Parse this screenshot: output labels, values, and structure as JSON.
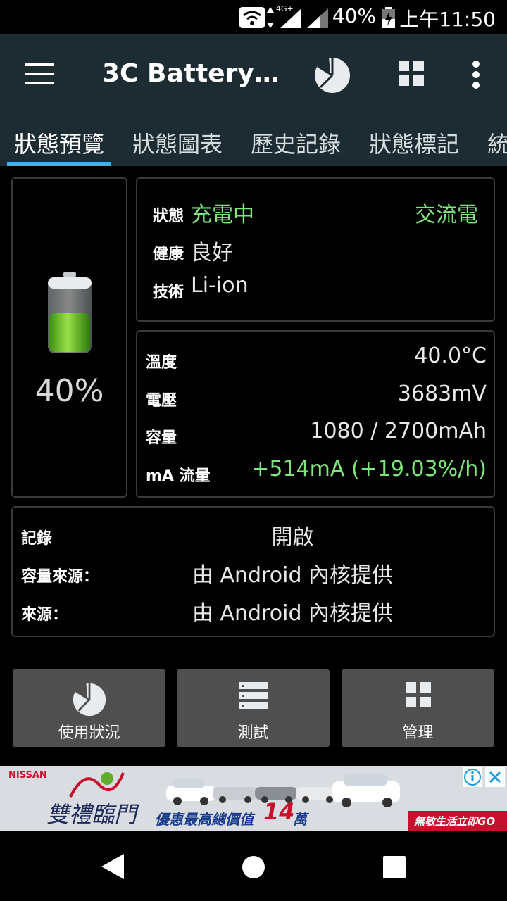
{
  "status_bar": {
    "battery_pct": "40%",
    "network": "4G+",
    "time": "上午11:50"
  },
  "app_bar": {
    "title": "3C Battery…"
  },
  "tabs": [
    {
      "label": "狀態預覽"
    },
    {
      "label": "狀態圖表"
    },
    {
      "label": "歷史記錄"
    },
    {
      "label": "狀態標記"
    },
    {
      "label": "統"
    }
  ],
  "battery": {
    "percent_text": "40%",
    "level": 0.4
  },
  "status_card": {
    "state_label": "狀態",
    "state_value": "充電中",
    "power_source": "交流電",
    "health_label": "健康",
    "health_value": "良好",
    "tech_label": "技術",
    "tech_value": "Li-ion"
  },
  "metrics_card": {
    "temp_label": "溫度",
    "temp_value": "40.0°C",
    "voltage_label": "電壓",
    "voltage_value": "3683mV",
    "capacity_label": "容量",
    "capacity_value": "1080 / 2700mAh",
    "flow_label": "mA 流量",
    "flow_value": "+514mA (+19.03%/h)"
  },
  "log_card": {
    "log_label": "記錄",
    "log_value": "開啟",
    "cap_source_label": "容量來源：",
    "cap_source_value": "由 Android 內核提供",
    "source_label": "來源：",
    "source_value": "由 Android 內核提供"
  },
  "buttons": {
    "usage": "使用狀況",
    "test": "測試",
    "manage": "管理"
  },
  "ad": {
    "brand": "NISSAN",
    "headline": "雙禮臨門",
    "tagline": "優惠最高總價值",
    "amount": "14",
    "amount_unit": "萬",
    "cta": "無敏生活立即GO"
  },
  "colors": {
    "accent": "#3fb0e8",
    "green": "#7ee67a",
    "app_bar": "#1d2b32"
  }
}
